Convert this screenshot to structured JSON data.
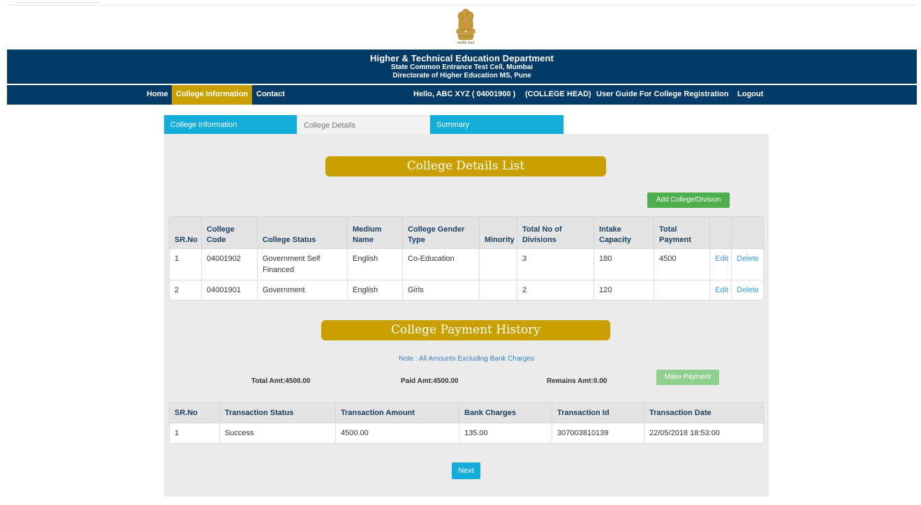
{
  "header": {
    "emblem_caption": "सत्यमेव जयते",
    "title": "Higher & Technical Education Department",
    "subtitle1": "State Common Entrance Test Cell, Mumbai",
    "subtitle2": "Directorate of Higher Education MS, Pune"
  },
  "nav": {
    "items": [
      "Home",
      "College Information",
      "Contact"
    ],
    "active": "College Information",
    "greeting": "Hello, ABC XYZ ( 04001900 )",
    "role": "(COLLEGE HEAD)",
    "guide": "User Guide For College Registration",
    "logout": "Logout"
  },
  "tabs": [
    {
      "label": "College Information",
      "active": true
    },
    {
      "label": "College Details",
      "active": false
    },
    {
      "label": "Summary",
      "active": true
    }
  ],
  "details": {
    "heading": "College Details List",
    "add_button": "Add College/Division",
    "columns": [
      "SR.No",
      "College Code",
      "College Status",
      "Medium Name",
      "College Gender Type",
      "Minority",
      "Total No of Divisions",
      "Intake Capacity",
      "Total Payment",
      "",
      ""
    ],
    "rows": [
      {
        "sr": "1",
        "code": "04001902",
        "status": "Government Self Financed",
        "medium": "English",
        "gender": "Co-Education",
        "minority": "",
        "divisions": "3",
        "intake": "180",
        "payment": "4500",
        "edit": "Edit",
        "delete": "Delete"
      },
      {
        "sr": "2",
        "code": "04001901",
        "status": "Government",
        "medium": "English",
        "gender": "Girls",
        "minority": "",
        "divisions": "2",
        "intake": "120",
        "payment": "",
        "edit": "Edit",
        "delete": "Delete"
      }
    ]
  },
  "payment": {
    "heading": "College Payment History",
    "note": "Note : All Amounts Excluding Bank Charges",
    "total": "Total Amt:4500.00",
    "paid": "Paid Amt:4500.00",
    "remains": "Remains Amt:0.00",
    "make_payment": "Make Payment",
    "columns": [
      "SR.No",
      "Transaction Status",
      "Transaction Amount",
      "Bank Charges",
      "Transaction Id",
      "Transaction Date"
    ],
    "rows": [
      {
        "sr": "1",
        "status": "Success",
        "amount": "4500.00",
        "charges": "135.00",
        "txn_id": "307003810139",
        "date": "22/05/2018 18:53:00"
      }
    ]
  },
  "next_button": "Next",
  "colors": {
    "navy": "#033a66",
    "gold": "#c9a000",
    "tab_blue": "#14acd8",
    "green": "#4cae4c",
    "link": "#3a9bd5"
  },
  "icons": [
    "emblem-icon"
  ]
}
